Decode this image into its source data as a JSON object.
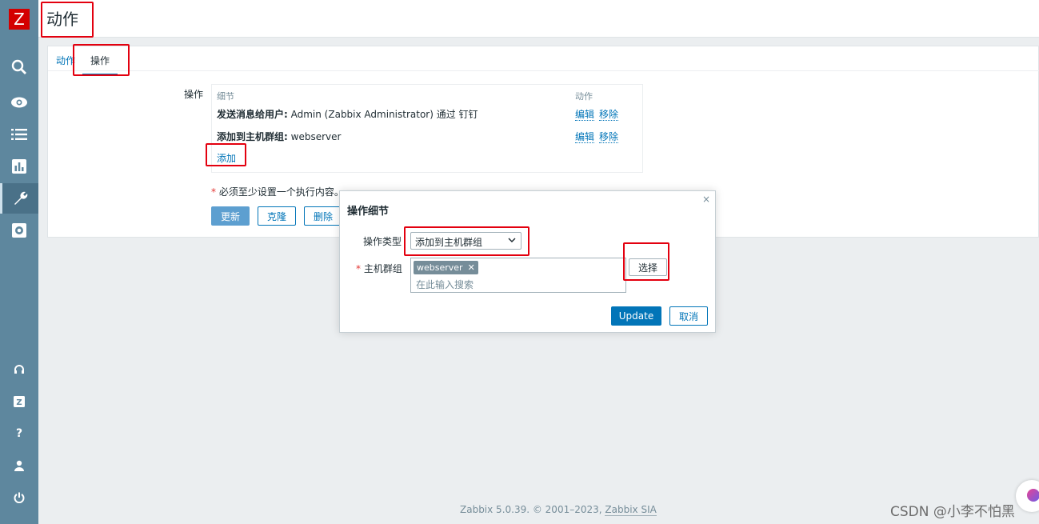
{
  "app": {
    "logo": "Z",
    "page_title": "动作"
  },
  "sidebar": {
    "icons": [
      "search-icon",
      "eye-icon",
      "list-icon",
      "chart-icon",
      "wrench-icon",
      "gear-icon"
    ],
    "bottom_icons": [
      "headset-icon",
      "zabbix-z-icon",
      "help-icon",
      "user-icon",
      "power-icon"
    ],
    "help_glyph": "?",
    "z_glyph": "Z",
    "active": "wrench-icon"
  },
  "tabs": [
    {
      "label": "动作"
    },
    {
      "label": "操作"
    }
  ],
  "operations": {
    "label": "操作",
    "col_details": "细节",
    "col_action": "动作",
    "rows": [
      {
        "bold": "发送消息给用户:",
        "text": " Admin (Zabbix Administrator) 通过 钉钉",
        "edit": "编辑",
        "remove": "移除"
      },
      {
        "bold": "添加到主机群组:",
        "text": " webserver",
        "edit": "编辑",
        "remove": "移除"
      }
    ],
    "add_label": "添加"
  },
  "hint": {
    "star": "*",
    "text": " 必须至少设置一个执行内容。"
  },
  "buttons": {
    "update": "更新",
    "clone": "克隆",
    "delete": "删除"
  },
  "modal": {
    "title": "操作细节",
    "close": "×",
    "type_label": "操作类型",
    "type_value": "添加到主机群组",
    "group_star": "*",
    "group_label": " 主机群组",
    "chip_label": "webserver",
    "chip_remove": "✕",
    "search_placeholder": "在此输入搜索",
    "select_button": "选择",
    "update_button": "Update",
    "cancel_button": "取消"
  },
  "footer": {
    "text": "Zabbix 5.0.39. © 2001–2023, ",
    "link": "Zabbix SIA"
  },
  "watermark": "CSDN @小李不怕黑",
  "colors": {
    "sidebar": "#5e879e",
    "accent": "#0275b8",
    "annotation": "#e3000f",
    "logo": "#d40000"
  }
}
